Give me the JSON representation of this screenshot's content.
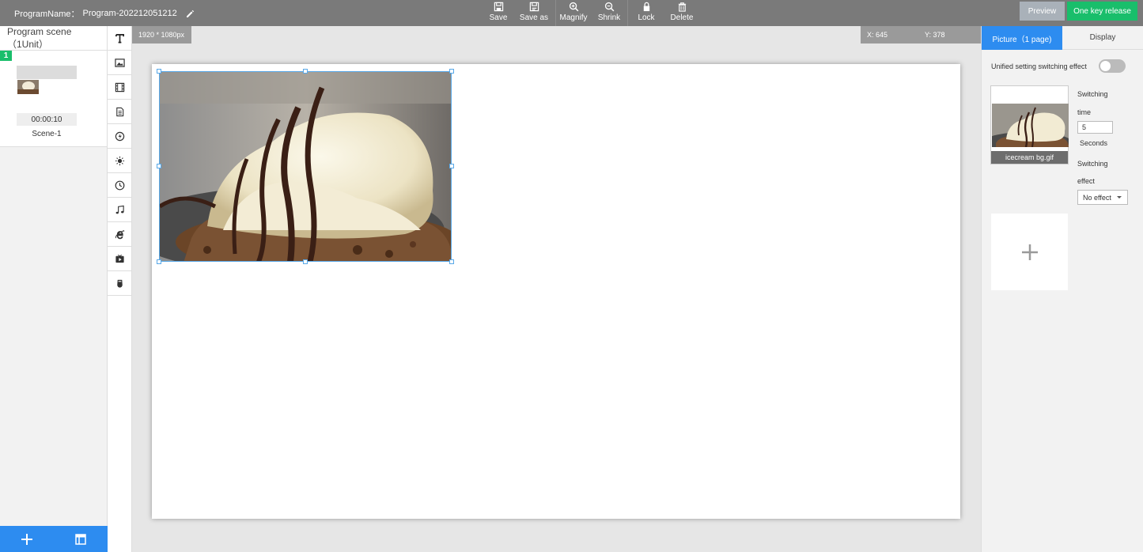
{
  "header": {
    "program_label": "ProgramName：",
    "program_name": "Program-202212051212",
    "tools": [
      {
        "label": "Save",
        "icon": "save-icon"
      },
      {
        "label": "Save as",
        "icon": "save-as-icon"
      },
      {
        "label": "Magnify",
        "icon": "zoom-in-icon"
      },
      {
        "label": "Shrink",
        "icon": "zoom-out-icon"
      },
      {
        "label": "Lock",
        "icon": "lock-icon"
      },
      {
        "label": "Delete",
        "icon": "trash-icon"
      }
    ],
    "preview_label": "Preview",
    "release_label": "One key release",
    "colors": {
      "topbar": "#7a7a7a",
      "preview": "#a9b1b9",
      "release": "#19be6b",
      "accent": "#2d8cf0"
    }
  },
  "scenes": {
    "header": "Program scene（1Unit）",
    "items": [
      {
        "number": "1",
        "duration": "00:00:10",
        "name": "Scene-1"
      }
    ]
  },
  "widget_icons": [
    "text-icon",
    "image-icon",
    "video-icon",
    "document-icon",
    "flash-icon",
    "weather-icon",
    "clock-icon",
    "music-icon",
    "browser-icon",
    "stream-icon",
    "sensor-icon"
  ],
  "canvas": {
    "resolution": "1920 * 1080px",
    "x_readout": "X: 645",
    "y_readout": "Y: 378"
  },
  "panel": {
    "tab_picture": "Picture（1 page)",
    "tab_display": "Display",
    "unified_label": "Unified setting switching effect",
    "unified_on": false,
    "picture_name": "icecream bg.gif",
    "switching_label": "Switching",
    "time_label": "time",
    "time_value": "5",
    "seconds_label": "Seconds",
    "switching_label2": "Switching",
    "effect_label": "effect",
    "effect_value": "No effect"
  }
}
